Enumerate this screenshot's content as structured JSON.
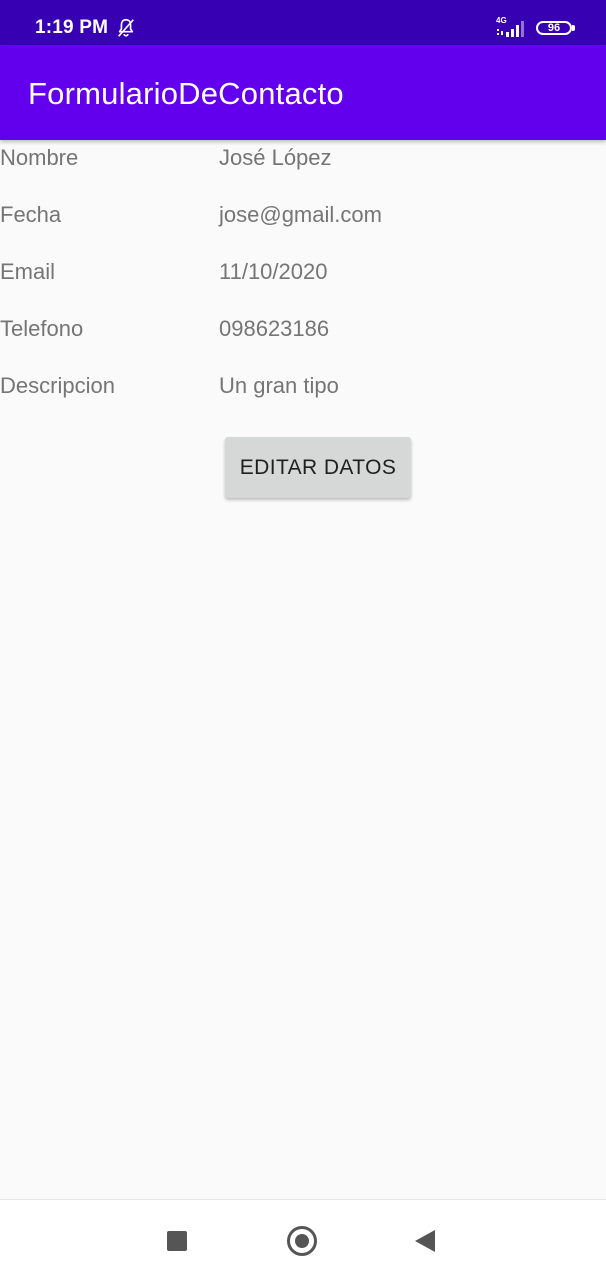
{
  "status_bar": {
    "time": "1:19 PM",
    "network": "4G",
    "battery": "96",
    "icons": [
      "bell-off-icon",
      "signal-icon",
      "battery-icon"
    ]
  },
  "app_bar": {
    "title": "FormularioDeContacto"
  },
  "fields": [
    {
      "label": "Nombre",
      "value": "José López"
    },
    {
      "label": "Fecha",
      "value": "jose@gmail.com"
    },
    {
      "label": "Email",
      "value": "11/10/2020"
    },
    {
      "label": "Telefono",
      "value": "098623186"
    },
    {
      "label": "Descripcion",
      "value": "Un gran tipo"
    }
  ],
  "actions": {
    "edit_label": "EDITAR DATOS"
  },
  "nav_bar": {
    "icons": [
      "recents-icon",
      "home-icon",
      "back-icon"
    ]
  },
  "colors": {
    "status_bar": "#3700b3",
    "app_bar": "#6200ee",
    "background": "#fafafa",
    "text_secondary": "#757575",
    "button": "#d6d7d7"
  }
}
